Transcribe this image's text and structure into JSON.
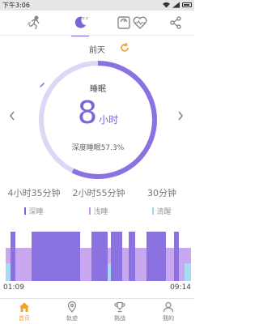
{
  "status_bar": {
    "time": "下午3:06"
  },
  "top_nav": {
    "items": [
      {
        "name": "running-icon",
        "active": false
      },
      {
        "name": "moon-sleep-icon",
        "active": true
      },
      {
        "name": "scale-icon",
        "active": false
      },
      {
        "name": "heart-rate-icon",
        "active": false
      },
      {
        "name": "share-icon",
        "active": false
      }
    ]
  },
  "date": {
    "label": "前天"
  },
  "sleep": {
    "title": "睡眠",
    "hours": "8",
    "hours_unit": "小时",
    "deep_ratio_text": "深度睡眠57.3%",
    "deep_ratio": 0.573
  },
  "stats": [
    {
      "value": "4小时35分钟",
      "legend": "深睡",
      "color": "#7b63d9"
    },
    {
      "value": "2小时55分钟",
      "legend": "浅睡",
      "color": "#c49be8"
    },
    {
      "value": "30分钟",
      "legend": "清醒",
      "color": "#9fd8ef"
    }
  ],
  "timeline": {
    "start": "01:09",
    "end": "09:14",
    "colors": {
      "deep": "#8a72e0",
      "light": "#c9a8ef",
      "awake": "#a8dcf2"
    }
  },
  "bottom_nav": [
    {
      "label": "首页",
      "icon": "home-icon",
      "active": true
    },
    {
      "label": "轨迹",
      "icon": "location-pin-icon",
      "active": false
    },
    {
      "label": "挑战",
      "icon": "trophy-icon",
      "active": false
    },
    {
      "label": "我的",
      "icon": "user-icon",
      "active": false
    }
  ]
}
